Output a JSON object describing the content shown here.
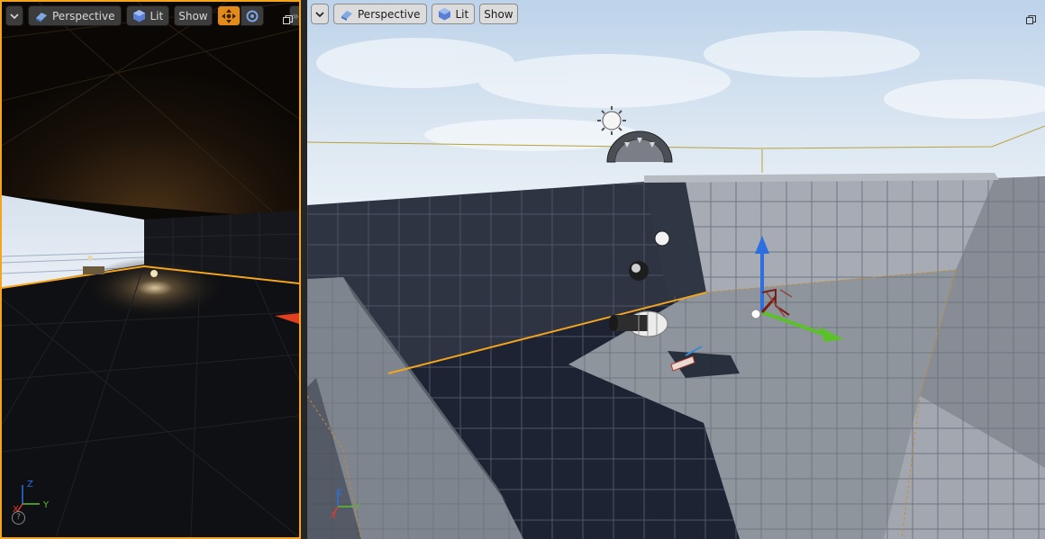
{
  "viewports": {
    "left": {
      "view_mode_label": "Perspective",
      "lighting_label": "Lit",
      "show_label": "Show",
      "overflow_label": "»",
      "help_label": "?"
    },
    "right": {
      "view_mode_label": "Perspective",
      "lighting_label": "Lit",
      "show_label": "Show"
    }
  },
  "axis_labels": {
    "z": "Z",
    "x": "X",
    "y": "Y"
  },
  "colors": {
    "selection_outline": "#f4a51c",
    "axis_x": "#e03a2b",
    "axis_y": "#5cc02a",
    "axis_z": "#2d6fe0",
    "sky": "#c6d9ec"
  },
  "icons": [
    "chevron-down-icon",
    "perspective-cube-icon",
    "lit-sphere-icon",
    "translate-icon",
    "rotate-icon",
    "maximize-icon",
    "sun-icon",
    "help-icon"
  ]
}
